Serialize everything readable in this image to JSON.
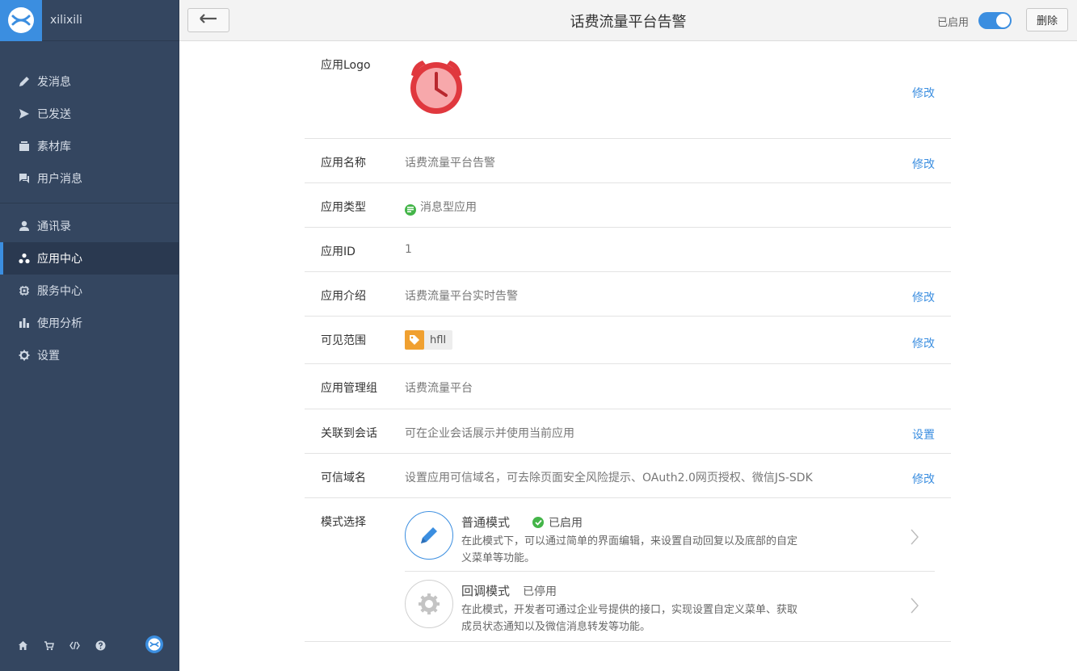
{
  "sidebar": {
    "org_name": "xilixili",
    "group1": [
      {
        "label": "发消息",
        "icon": "pencil-icon"
      },
      {
        "label": "已发送",
        "icon": "send-icon"
      },
      {
        "label": "素材库",
        "icon": "archive-icon"
      },
      {
        "label": "用户消息",
        "icon": "chat-icon"
      }
    ],
    "group2": [
      {
        "label": "通讯录",
        "icon": "user-icon"
      },
      {
        "label": "应用中心",
        "icon": "apps-icon",
        "active": true
      },
      {
        "label": "服务中心",
        "icon": "chip-icon"
      },
      {
        "label": "使用分析",
        "icon": "bar-chart-icon"
      },
      {
        "label": "设置",
        "icon": "gear-icon"
      }
    ],
    "footer_icons": [
      "home-icon",
      "cart-icon",
      "code-icon",
      "help-icon"
    ]
  },
  "header": {
    "title": "话费流量平台告警",
    "status_label": "已启用",
    "toggle_on": true,
    "delete_label": "删除"
  },
  "details": {
    "logo_label": "应用Logo",
    "logo_action": "修改",
    "name_label": "应用名称",
    "name_value": "话费流量平台告警",
    "name_action": "修改",
    "type_label": "应用类型",
    "type_value": "消息型应用",
    "id_label": "应用ID",
    "id_value": "1",
    "intro_label": "应用介绍",
    "intro_value": "话费流量平台实时告警",
    "intro_action": "修改",
    "scope_label": "可见范围",
    "scope_tag": "hflI",
    "scope_action": "修改",
    "admin_label": "应用管理组",
    "admin_value": "话费流量平台",
    "session_label": "关联到会话",
    "session_value": "可在企业会话展示并使用当前应用",
    "session_action": "设置",
    "domain_label": "可信域名",
    "domain_value": "设置应用可信域名，可去除页面安全风险提示、OAuth2.0网页授权、微信JS-SDK",
    "domain_action": "修改",
    "mode_label": "模式选择"
  },
  "modes": {
    "normal": {
      "title": "普通模式",
      "status": "已启用",
      "desc": "在此模式下，可以通过简单的界面编辑，来设置自动回复以及底部的自定义菜单等功能。"
    },
    "callback": {
      "title": "回调模式",
      "status": "已停用",
      "desc": "在此模式，开发者可通过企业号提供的接口，实现设置自定义菜单、获取成员状态通知以及微信消息转发等功能。"
    }
  },
  "colors": {
    "accent": "#3b8ee0",
    "sidebar_bg": "#344660",
    "success": "#44b549",
    "tag": "#f0a030",
    "alarm": "#e0383e"
  }
}
